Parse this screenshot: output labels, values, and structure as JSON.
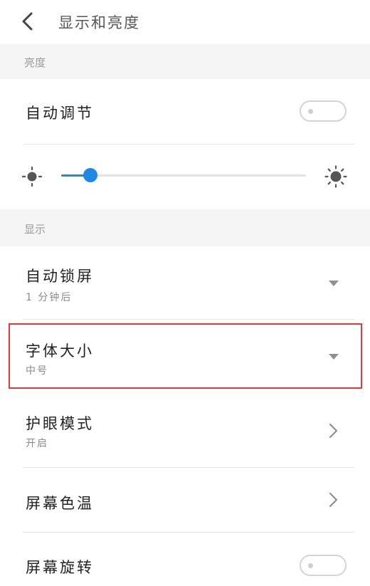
{
  "header": {
    "title": "显示和亮度",
    "back_icon": "chevron-left-icon"
  },
  "brightness_section": {
    "label": "亮度",
    "auto_adjust": {
      "title": "自动调节",
      "toggle_on": false
    },
    "slider": {
      "value_fraction": 0.12,
      "low_icon": "sun-small-icon",
      "high_icon": "sun-large-icon"
    }
  },
  "display_section": {
    "label": "显示",
    "items": [
      {
        "title": "自动锁屏",
        "subtitle": "1 分钟后",
        "control": "dropdown"
      },
      {
        "title": "字体大小",
        "subtitle": "中号",
        "control": "dropdown"
      },
      {
        "title": "护眼模式",
        "subtitle": "开启",
        "control": "chevron"
      },
      {
        "title": "屏幕色温",
        "control": "chevron"
      },
      {
        "title": "屏幕旋转",
        "control": "toggle",
        "toggle_on": false
      }
    ]
  },
  "colors": {
    "accent": "#1e88e5",
    "highlight": "#e53935",
    "section_bg": "#f5f5f5"
  }
}
